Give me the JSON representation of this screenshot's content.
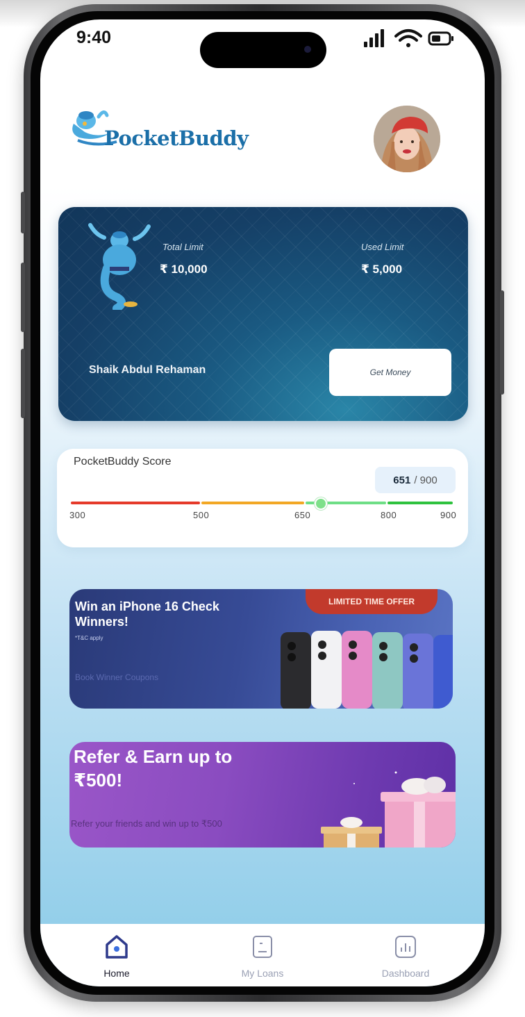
{
  "status_bar": {
    "time": "9:40"
  },
  "header": {
    "logo_text": "PocketBuddy",
    "avatar_alt": "profile"
  },
  "limit_card": {
    "total_limit_label": "Total Limit",
    "total_limit_value": "₹ 10,000",
    "used_limit_label": "Used Limit",
    "used_limit_value": "₹ 5,000",
    "card_holder": "Shaik Abdul Rehaman",
    "get_money_label": "Get Money"
  },
  "score": {
    "title": "PocketBuddy Score",
    "value": "651",
    "max": "/ 900",
    "score_value": 651,
    "range_min": 300,
    "range_max": 900,
    "ticks": [
      "300",
      "500",
      "650",
      "800",
      "900"
    ],
    "colors": {
      "low": "#e53a2a",
      "mid": "#f2a724",
      "good": "#6ede86",
      "excellent": "#2ec23e"
    }
  },
  "banners": [
    {
      "title": "Win an iPhone 16 Check Winners!",
      "sub": "*T&C apply",
      "note": "Book Winner Coupons",
      "tag": "LIMITED TIME OFFER"
    },
    {
      "title": "Refer & Earn up to ₹500!",
      "sub": "Refer your friends and win up to ₹500"
    }
  ],
  "nav": {
    "items": [
      {
        "label": "Home",
        "icon": "home-icon",
        "active": true
      },
      {
        "label": "My Loans",
        "icon": "loans-icon",
        "active": false
      },
      {
        "label": "Dashboard",
        "icon": "dashboard-icon",
        "active": false
      }
    ]
  },
  "accent": "#1b6fa8"
}
